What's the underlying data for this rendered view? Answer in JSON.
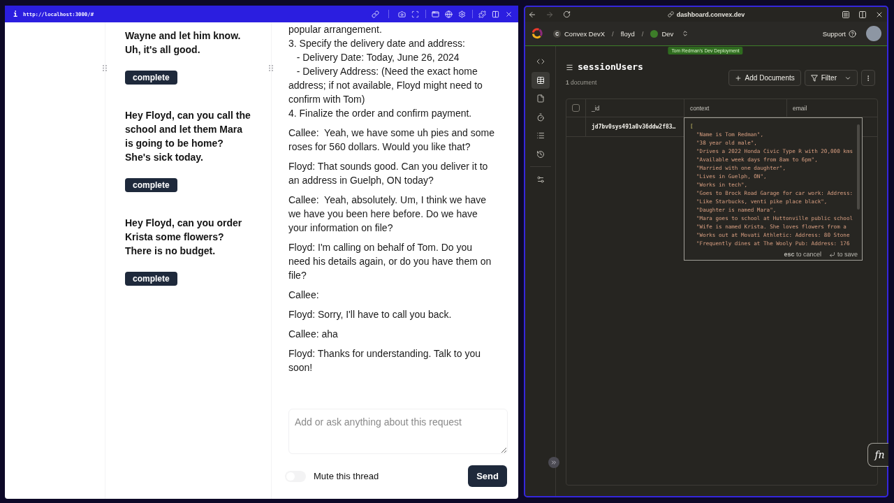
{
  "left_window": {
    "info_glyph": "i",
    "address": "http://localhost:3000/#",
    "tasks": [
      {
        "text": "Wayne and let him know.\nUh, it's all good.",
        "button": "complete"
      },
      {
        "text": "Hey Floyd, can you call the\nschool and let them Mara\nis going to be home?\nShe's sick today.",
        "button": "complete"
      },
      {
        "text": "Hey Floyd, can you order\nKrista some flowers?\nThere is no budget.",
        "button": "complete"
      }
    ],
    "transcript": [
      "popular arrangement.\n3. Specify the delivery date and address:\n   - Delivery Date: Today, June 26, 2024\n   - Delivery Address: (Need the exact home\naddress; if not available, Floyd might need to\nconfirm with Tom)\n4. Finalize the order and confirm payment.",
      "Callee:  Yeah, we have some uh pies and some\nroses for 560 dollars. Would you like that?",
      "Floyd: That sounds good. Can you deliver it to\nan address in Guelph, ON today?",
      "Callee:  Yeah, absolutely. Um, I think we have\nwe have you been here before. Do we have\nyour information on file?",
      "Floyd: I'm calling on behalf of Tom. Do you\nneed his details again, or do you have them on\nfile?",
      "Callee:",
      "Floyd: Sorry, I'll have to call you back.",
      "Callee: aha",
      "Floyd: Thanks for understanding. Talk to you\nsoon!"
    ],
    "message_box": {
      "placeholder": "Add or ask anything about this request"
    },
    "mute_toggle": {
      "label": "Mute this thread",
      "on": false
    },
    "send_button": "Send"
  },
  "right_window": {
    "address": "dashboard.convex.dev",
    "breadcrumb": [
      {
        "kind": "team",
        "initial": "C",
        "label": "Convex DevX"
      },
      {
        "kind": "separator",
        "label": "/"
      },
      {
        "kind": "project",
        "label": "floyd"
      },
      {
        "kind": "separator",
        "label": "/"
      },
      {
        "kind": "deployment",
        "label": "Dev"
      }
    ],
    "support": "Support",
    "tooltip": "Tom Redman's Dev Deployment",
    "sidebar": {
      "items": [
        {
          "kind": "code",
          "selected": false
        },
        {
          "kind": "table",
          "selected": true
        },
        {
          "kind": "file",
          "selected": false
        },
        {
          "kind": "timer",
          "selected": false
        },
        {
          "kind": "list",
          "selected": false
        },
        {
          "kind": "history",
          "selected": false
        }
      ],
      "bottom_items": [
        {
          "kind": "sliders",
          "selected": false
        }
      ]
    },
    "table_name": "sessionUsers",
    "document_count": "**1** document",
    "actions": [
      {
        "kind": "add",
        "label": "Add Documents"
      },
      {
        "kind": "filter",
        "label": "Filter"
      },
      {
        "kind": "more"
      }
    ],
    "table": {
      "select_all": {
        "checked": false
      },
      "columns": [
        "_id",
        "context",
        "email"
      ],
      "rows": [
        {
          "id": "jd7bv0sys491a0v36ddw2f83…"
        }
      ]
    },
    "editor": {
      "lines": [
        {
          "kind": "bracket",
          "text": "["
        },
        {
          "kind": "string",
          "text": "\"Name is Tom Redman\","
        },
        {
          "kind": "string",
          "text": "\"38 year old male\","
        },
        {
          "kind": "string",
          "text": "\"Drives a 2022 Honda Civic Type R with 20,000 kms"
        },
        {
          "kind": "string",
          "text": "\"Available week days from 8am to 6pm\","
        },
        {
          "kind": "string",
          "text": "\"Married with one daughter\","
        },
        {
          "kind": "string",
          "text": "\"Lives in Guelph, ON\","
        },
        {
          "kind": "string",
          "text": "\"Works in tech\","
        },
        {
          "kind": "string",
          "text": "\"Goes to Brock Road Garage for car work: Address:"
        },
        {
          "kind": "string",
          "text": "\"Like Starbucks, venti pike place black\","
        },
        {
          "kind": "string",
          "text": "\"Daughter is named Mara\","
        },
        {
          "kind": "string",
          "text": "\"Mara goes to school at Huttonville public school"
        },
        {
          "kind": "string",
          "text": "\"Wife is named Krista. She loves flowers from a"
        },
        {
          "kind": "string",
          "text": "\"Works out at Movati Athletic: Address: 80 Stone"
        },
        {
          "kind": "string",
          "text": "\"Frequently dines at The Wooly Pub: Address: 176"
        }
      ],
      "hints": [
        {
          "kind": "text",
          "label": "**esc** to cancel"
        },
        {
          "kind": "enter",
          "label": "to save"
        }
      ]
    },
    "fn_button": "fn"
  }
}
